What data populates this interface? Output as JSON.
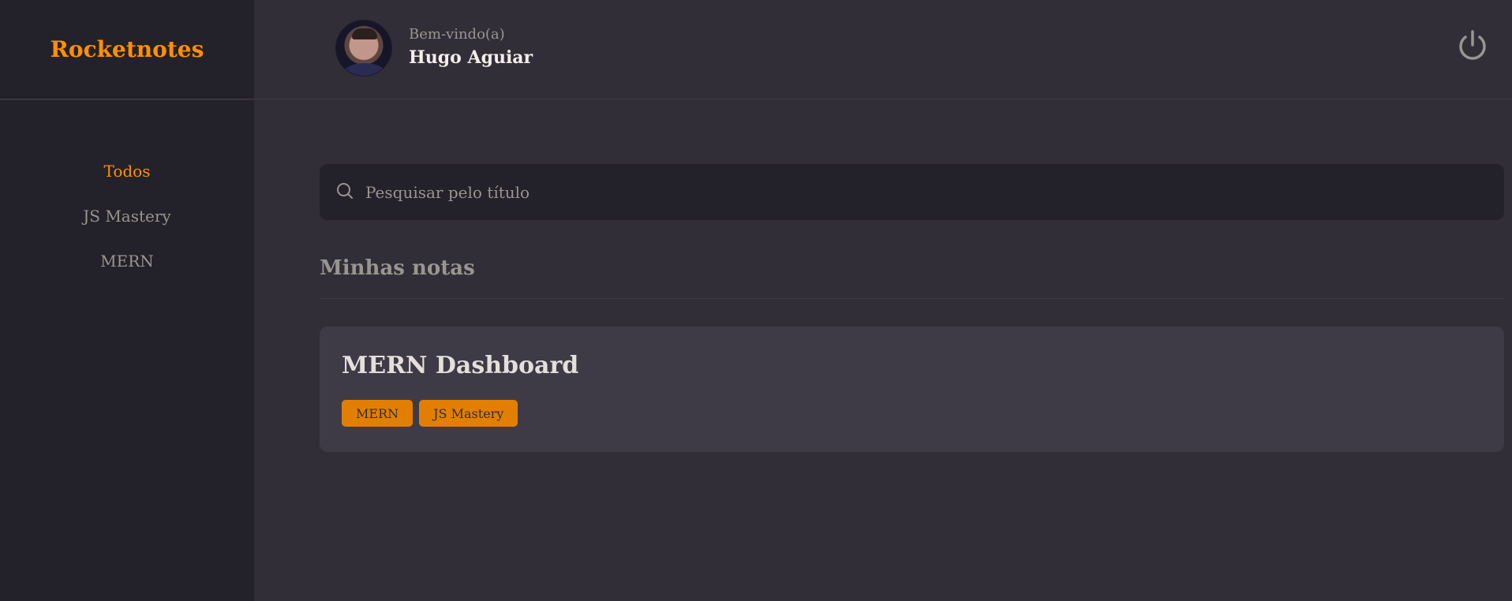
{
  "brand": {
    "title": "Rocketnotes"
  },
  "sidebar": {
    "items": [
      {
        "label": "Todos",
        "active": true
      },
      {
        "label": "JS Mastery",
        "active": false
      },
      {
        "label": "MERN",
        "active": false
      }
    ]
  },
  "header": {
    "welcome": "Bem-vindo(a)",
    "user_name": "Hugo Aguiar",
    "logout_icon": "power-icon"
  },
  "search": {
    "placeholder": "Pesquisar pelo título",
    "value": "",
    "icon": "search-icon"
  },
  "section": {
    "title": "Minhas notas"
  },
  "notes": [
    {
      "title": "MERN Dashboard",
      "tags": [
        "MERN",
        "JS Mastery"
      ]
    }
  ],
  "colors": {
    "accent": "#ff9000",
    "tag_bg": "#e37f00",
    "background": "#312e38",
    "sidebar_bg": "#232129",
    "card_bg": "#3e3b47"
  }
}
